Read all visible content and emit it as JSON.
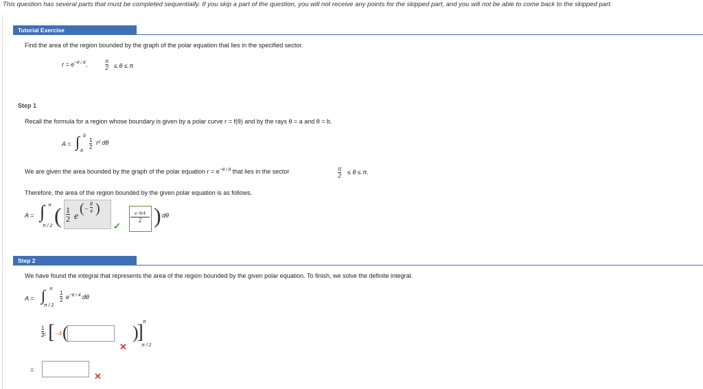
{
  "notice": "This question has several parts that must be completed sequentially. If you skip a part of the question, you will not receive any points for the skipped part, and you will not be able to come back to the skipped part.",
  "tutorial": {
    "header": "Tutorial Exercise",
    "prompt": "Find the area of the region bounded by the graph of the polar equation that lies in the specified sector.",
    "eq_r": "r = e",
    "eq_exp": "−θ / 8",
    "eq_comma": ",",
    "eq_pi": "π",
    "eq_two": "2",
    "eq_range": "≤ θ ≤ π"
  },
  "step1": {
    "label": "Step 1",
    "recall": "Recall the formula for a region whose boundary is given by a polar curve r = f(θ) and by the rays θ = a and θ = b.",
    "formula_A": "A =",
    "formula_upper": "b",
    "formula_lower": "a",
    "formula_one": "1",
    "formula_two": "2",
    "formula_tail": "r² dθ",
    "given_prefix": "We are given the area bounded by the graph of the polar equation r = e",
    "given_exp": "−θ / 8",
    "given_suffix": "that lies in the sector",
    "given_pi": "π",
    "given_two": "2",
    "given_range": "≤ θ ≤ π.",
    "therefore": "Therefore, the area of the region bounded by the given polar equation is as follows.",
    "int_A": "A =",
    "int_upper": "π",
    "int_lower": "π / 2",
    "box1_num": "1",
    "box1_den": "2",
    "box1_e": "e",
    "box1_exp_num": "θ",
    "box1_exp_den": "4",
    "box1_minus": "−",
    "ans_num": "e−θ/4",
    "ans_den": "2",
    "dtheta": "dθ"
  },
  "step2": {
    "label": "Step 2",
    "intro": "We have found the integral that represents the area of the region bounded by the given polar equation. To finish, we solve the definite integral.",
    "A": "A =",
    "upper": "π",
    "lower": "π / 2",
    "one": "1",
    "two": "2",
    "e_exp": "e",
    "exp": "−θ / 4",
    "dtheta": "dθ",
    "eq": "=",
    "half_one": "1",
    "half_two": "2",
    "neg_four": "−4",
    "eval_upper": "π",
    "eval_lower": "π / 2",
    "eq2": "=",
    "input1_value": "",
    "input2_value": ""
  },
  "colors": {
    "header_blue": "#3f6fb5",
    "check_green": "#3a9a2e",
    "cross_red": "#d23a3a"
  }
}
